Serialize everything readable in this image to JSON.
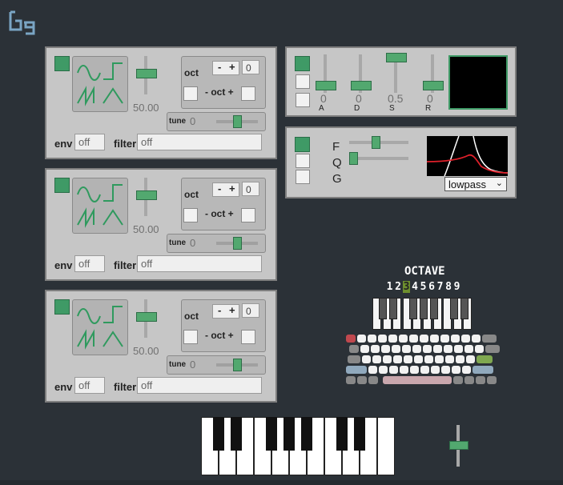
{
  "oscillators": [
    {
      "slider_value": "50.00",
      "env": "off",
      "filter": "off",
      "oct_label": "oct",
      "oct_value": "0",
      "oct_plus_minus": "- oct +",
      "tune_label": "tune",
      "tune_value": "0",
      "minus": "-",
      "plus": "+"
    },
    {
      "slider_value": "50.00",
      "env": "off",
      "filter": "off",
      "oct_label": "oct",
      "oct_value": "0",
      "oct_plus_minus": "- oct +",
      "tune_label": "tune",
      "tune_value": "0",
      "minus": "-",
      "plus": "+"
    },
    {
      "slider_value": "50.00",
      "env": "off",
      "filter": "off",
      "oct_label": "oct",
      "oct_value": "0",
      "oct_plus_minus": "- oct +",
      "tune_label": "tune",
      "tune_value": "0",
      "minus": "-",
      "plus": "+"
    }
  ],
  "labels": {
    "env": "env",
    "filter": "filter"
  },
  "adsr": {
    "values": [
      "0",
      "0",
      "0.5",
      "0"
    ],
    "names": [
      "A",
      "D",
      "S",
      "R"
    ]
  },
  "filter_panel": {
    "labels": [
      "F",
      "Q",
      "G"
    ],
    "type_selected": "lowpass"
  },
  "octave": {
    "title": "OCTAVE",
    "numbers": [
      "1",
      "2",
      "3",
      "4",
      "5",
      "6",
      "7",
      "8",
      "9"
    ],
    "selected": "3"
  },
  "colors": {
    "background": "#2b3137",
    "panel": "#c6c6c6",
    "accent_green": "#3f9a66",
    "filter_curve": "#e0202a"
  }
}
